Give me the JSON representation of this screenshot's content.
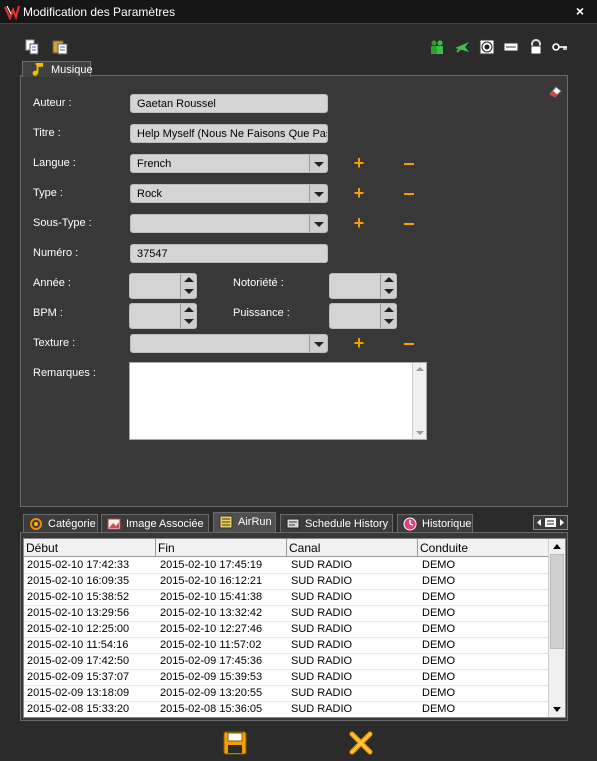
{
  "window": {
    "title": "Modification des Paramètres",
    "close_glyph": "×"
  },
  "toolbar": {
    "left_icons": [
      "copy-icon",
      "paste-icon"
    ],
    "right_icons": [
      "people-icon",
      "plane-icon",
      "target-icon",
      "card-icon",
      "lock-icon",
      "key-icon"
    ]
  },
  "main_tab": {
    "label": "Musique",
    "icon": "music-note-icon"
  },
  "form": {
    "auteur_label": "Auteur :",
    "auteur_value": "Gaetan Roussel",
    "titre_label": "Titre :",
    "titre_value": "Help Myself (Nous Ne Faisons Que Pas",
    "langue_label": "Langue :",
    "langue_value": "French",
    "type_label": "Type :",
    "type_value": "Rock",
    "soustype_label": "Sous-Type :",
    "soustype_value": "",
    "numero_label": "Numéro :",
    "numero_value": "37547",
    "annee_label": "Année :",
    "annee_value": "",
    "notoriete_label": "Notoriété :",
    "notoriete_value": "",
    "bpm_label": "BPM :",
    "bpm_value": "",
    "puissance_label": "Puissance :",
    "puissance_value": "",
    "texture_label": "Texture :",
    "texture_value": "",
    "remarques_label": "Remarques :",
    "remarques_value": "",
    "plus_glyph": "+"
  },
  "bottom_tabs": [
    {
      "label": "Catégorie",
      "icon": "category-icon"
    },
    {
      "label": "Image Associée",
      "icon": "image-icon"
    },
    {
      "label": "AirRun",
      "icon": "list-icon"
    },
    {
      "label": "Schedule History",
      "icon": "monitor-icon"
    },
    {
      "label": "Historique",
      "icon": "clock-icon"
    }
  ],
  "grid": {
    "columns": [
      "Début",
      "Fin",
      "Canal",
      "Conduite"
    ],
    "rows": [
      [
        "2015-02-10 17:42:33",
        "2015-02-10 17:45:19",
        "SUD RADIO",
        "DEMO"
      ],
      [
        "2015-02-10 16:09:35",
        "2015-02-10 16:12:21",
        "SUD RADIO",
        "DEMO"
      ],
      [
        "2015-02-10 15:38:52",
        "2015-02-10 15:41:38",
        "SUD RADIO",
        "DEMO"
      ],
      [
        "2015-02-10 13:29:56",
        "2015-02-10 13:32:42",
        "SUD RADIO",
        "DEMO"
      ],
      [
        "2015-02-10 12:25:00",
        "2015-02-10 12:27:46",
        "SUD RADIO",
        "DEMO"
      ],
      [
        "2015-02-10 11:54:16",
        "2015-02-10 11:57:02",
        "SUD RADIO",
        "DEMO"
      ],
      [
        "2015-02-09 17:42:50",
        "2015-02-09 17:45:36",
        "SUD RADIO",
        "DEMO"
      ],
      [
        "2015-02-09 15:37:07",
        "2015-02-09 15:39:53",
        "SUD RADIO",
        "DEMO"
      ],
      [
        "2015-02-09 13:18:09",
        "2015-02-09 13:20:55",
        "SUD RADIO",
        "DEMO"
      ],
      [
        "2015-02-08 15:33:20",
        "2015-02-08 15:36:05",
        "SUD RADIO",
        "DEMO"
      ]
    ]
  },
  "footer": {
    "save_icon": "floppy-save-icon",
    "cancel_icon": "cancel-x-icon"
  },
  "colors": {
    "accent": "#f5a000",
    "background": "#2b2b2b",
    "panel": "#383838",
    "field": "#d4d4d4"
  }
}
